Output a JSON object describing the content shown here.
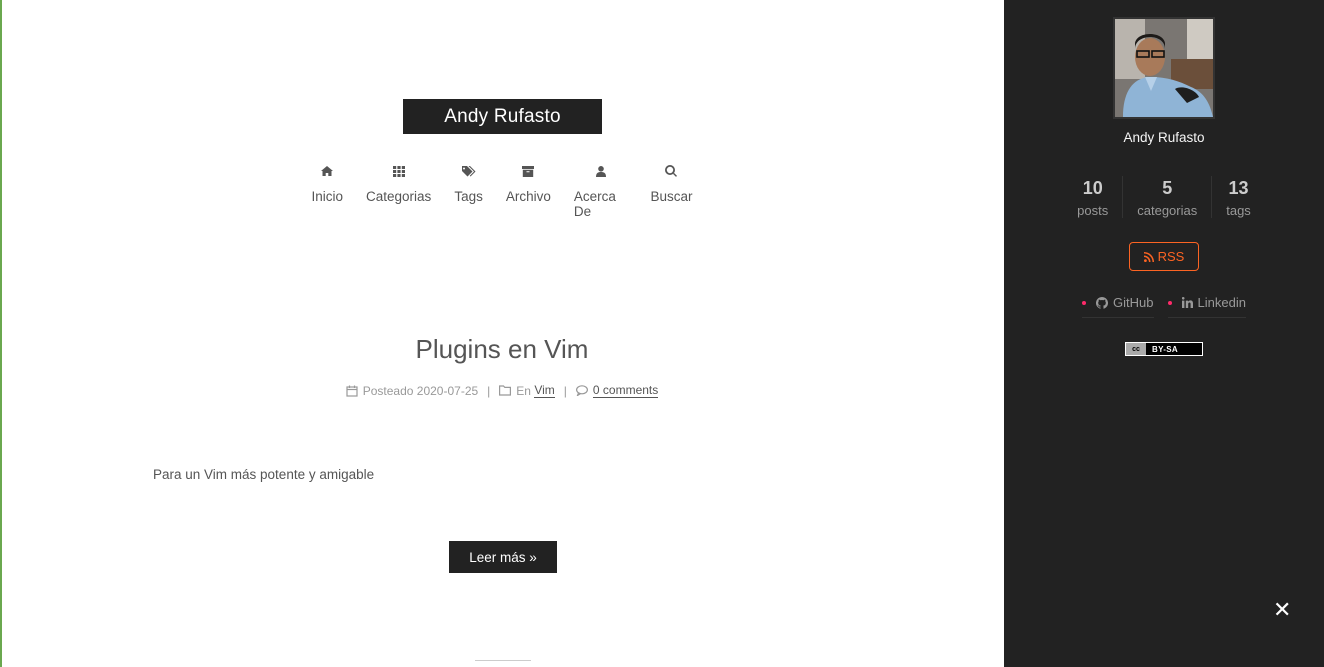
{
  "site": {
    "title": "Andy Rufasto"
  },
  "menu": {
    "items": [
      {
        "label": "Inicio",
        "icon": "home-icon"
      },
      {
        "label": "Categorias",
        "icon": "th-icon"
      },
      {
        "label": "Tags",
        "icon": "tags-icon"
      },
      {
        "label": "Archivo",
        "icon": "archive-icon"
      },
      {
        "label": "Acerca De",
        "icon": "user-icon"
      },
      {
        "label": "Buscar",
        "icon": "search-icon"
      }
    ]
  },
  "post": {
    "title": "Plugins en Vim",
    "posted_label": "Posteado",
    "date": "2020-07-25",
    "in_label": "En",
    "category": "Vim",
    "comments": "0 comments",
    "excerpt": "Para un Vim más potente y amigable",
    "read_more": "Leer más »"
  },
  "sidebar": {
    "author_name": "Andy Rufasto",
    "stats": [
      {
        "num": "10",
        "label": "posts"
      },
      {
        "num": "5",
        "label": "categorias"
      },
      {
        "num": "13",
        "label": "tags"
      }
    ],
    "rss_label": "RSS",
    "links": [
      {
        "label": "GitHub",
        "icon": "github-icon"
      },
      {
        "label": "Linkedin",
        "icon": "linkedin-icon"
      }
    ],
    "license_label": "BY-SA",
    "license_cc": "cc",
    "close_symbol": "✕"
  },
  "colors": {
    "sidebar_bg": "#222222",
    "accent": "#fc6423",
    "link_dot": "#ff2a6a",
    "left_edge": "#6aa84f"
  }
}
